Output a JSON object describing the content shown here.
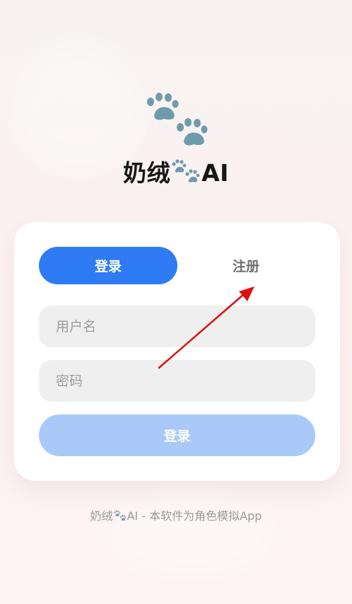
{
  "brand": {
    "name_prefix": "奶绒",
    "name_suffix": "AI"
  },
  "tabs": {
    "login_label": "登录",
    "register_label": "注册"
  },
  "form": {
    "username_placeholder": "用户名",
    "password_placeholder": "密码",
    "submit_label": "登录"
  },
  "footer": {
    "prefix": "奶绒",
    "suffix": "AI - 本软件为角色模拟App"
  },
  "colors": {
    "accent": "#2f7bf3",
    "submit_disabled": "#a9c9f9",
    "paw": "#6e9bab",
    "annotation": "#e01010"
  },
  "icons": {
    "logo": "paw-prints-icon",
    "inline": "paw-prints-icon",
    "annotation": "red-arrow-icon"
  }
}
